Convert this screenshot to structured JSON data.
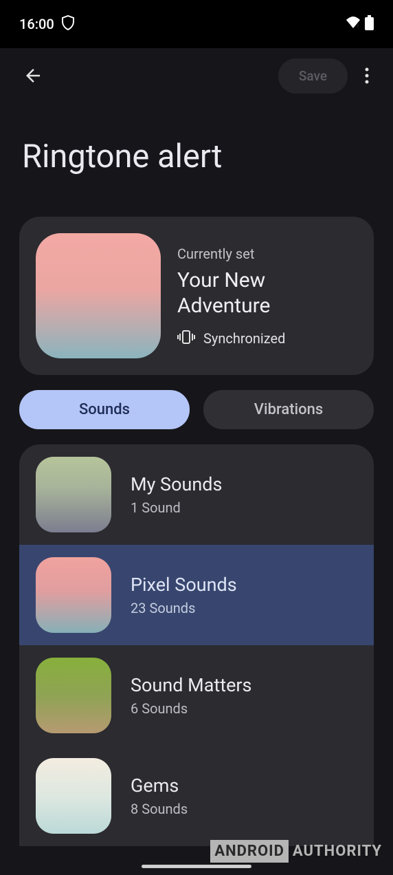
{
  "status_bar": {
    "time": "16:00"
  },
  "app_bar": {
    "save_label": "Save"
  },
  "page_title": "Ringtone alert",
  "current": {
    "label": "Currently set",
    "title": "Your New Adventure",
    "sync_label": "Synchronized"
  },
  "tabs": {
    "sounds": "Sounds",
    "vibrations": "Vibrations"
  },
  "categories": [
    {
      "title": "My Sounds",
      "subtitle": "1 Sound"
    },
    {
      "title": "Pixel Sounds",
      "subtitle": "23 Sounds"
    },
    {
      "title": "Sound Matters",
      "subtitle": "6 Sounds"
    },
    {
      "title": "Gems",
      "subtitle": "8 Sounds"
    }
  ],
  "watermark": {
    "part1": "ANDROID",
    "part2": "AUTHORITY"
  }
}
